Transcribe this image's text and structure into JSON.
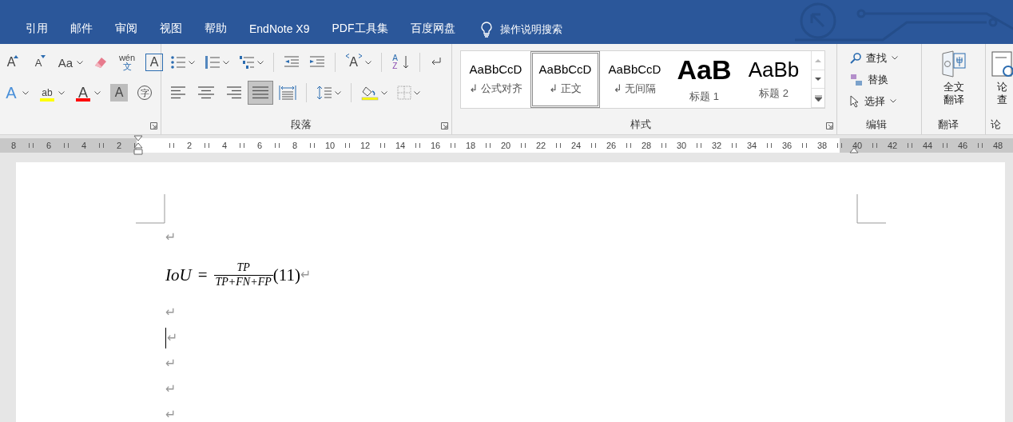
{
  "tabs": [
    {
      "label": "引用",
      "selected": false
    },
    {
      "label": "邮件",
      "selected": false
    },
    {
      "label": "审阅",
      "selected": false
    },
    {
      "label": "视图",
      "selected": false
    },
    {
      "label": "帮助",
      "selected": false
    },
    {
      "label": "EndNote X9",
      "selected": false
    },
    {
      "label": "PDF工具集",
      "selected": false
    },
    {
      "label": "百度网盘",
      "selected": false
    }
  ],
  "tell_me": {
    "placeholder": "操作说明搜索"
  },
  "font_group": {
    "row1": [
      {
        "kind": "grow",
        "glyph": "A",
        "dropdown": false
      },
      {
        "kind": "shrink",
        "glyph": "A",
        "dropdown": false
      },
      {
        "kind": "case",
        "glyph": "Aa",
        "dropdown": true
      },
      {
        "kind": "eraser",
        "dropdown": false
      },
      {
        "kind": "phonetic",
        "glyph": "wén",
        "sub": "文",
        "dropdown": false
      },
      {
        "kind": "boxed",
        "glyph": "A",
        "dropdown": false
      }
    ],
    "row2": [
      {
        "kind": "effect",
        "glyph": "A",
        "dropdown": true
      },
      {
        "kind": "highlight",
        "glyph": "ab",
        "dropdown": true,
        "color": "#ffff00"
      },
      {
        "kind": "fontcolor",
        "glyph": "A",
        "dropdown": true,
        "color": "#ff0000"
      },
      {
        "kind": "shaded",
        "glyph": "A",
        "dropdown": false
      },
      {
        "kind": "enclosed",
        "glyph": "字",
        "dropdown": false
      }
    ]
  },
  "paragraph_group": {
    "label": "段落",
    "row1": [
      {
        "kind": "bullets",
        "dropdown": true,
        "selected": false
      },
      {
        "kind": "numbering",
        "dropdown": true,
        "selected": false
      },
      {
        "kind": "multilevel",
        "dropdown": true,
        "selected": false
      },
      {
        "kind": "sep"
      },
      {
        "kind": "outdent",
        "dropdown": false,
        "selected": false
      },
      {
        "kind": "indent",
        "dropdown": false,
        "selected": false
      },
      {
        "kind": "sep"
      },
      {
        "kind": "asian",
        "glyph": "A",
        "dropdown": true,
        "selected": false
      },
      {
        "kind": "sep"
      },
      {
        "kind": "sort",
        "glyph": "A",
        "sub": "Z",
        "dropdown": false,
        "selected": false
      },
      {
        "kind": "sep"
      },
      {
        "kind": "marks",
        "dropdown": false,
        "selected": false
      }
    ],
    "row2": [
      {
        "kind": "left",
        "dropdown": false,
        "selected": false
      },
      {
        "kind": "center",
        "dropdown": false,
        "selected": false
      },
      {
        "kind": "right",
        "dropdown": false,
        "selected": false
      },
      {
        "kind": "justify",
        "dropdown": false,
        "selected": true
      },
      {
        "kind": "distribute",
        "dropdown": false,
        "selected": false
      },
      {
        "kind": "sep"
      },
      {
        "kind": "spacing",
        "dropdown": true,
        "selected": false
      },
      {
        "kind": "sep"
      },
      {
        "kind": "shading",
        "dropdown": true,
        "selected": false
      },
      {
        "kind": "borders",
        "dropdown": true,
        "selected": false
      }
    ]
  },
  "styles_group": {
    "label": "样式",
    "items": [
      {
        "preview": "AaBbCcD",
        "name": "公式对齐",
        "mark": "↲",
        "kind": "normal",
        "selected": false
      },
      {
        "preview": "AaBbCcD",
        "name": "正文",
        "mark": "↲",
        "kind": "normal",
        "selected": true
      },
      {
        "preview": "AaBbCcD",
        "name": "无间隔",
        "mark": "↲",
        "kind": "normal",
        "selected": false
      },
      {
        "preview": "AaB",
        "name": "标题 1",
        "kind": "heading1",
        "selected": false
      },
      {
        "preview": "AaBb",
        "name": "标题 2",
        "kind": "heading2",
        "selected": false
      }
    ]
  },
  "editing_group": {
    "label": "编辑",
    "items": [
      {
        "kind": "find",
        "label": "查找",
        "dropdown": true
      },
      {
        "kind": "replace",
        "label": "替换",
        "dropdown": false
      },
      {
        "kind": "select",
        "label": "选择",
        "dropdown": true
      }
    ]
  },
  "translate_group": {
    "label": "翻译",
    "button": "全文翻译"
  },
  "paper_group": {
    "label": "论",
    "button": "论查"
  },
  "ruler": [
    {
      "label": "8",
      "margin": true
    },
    {
      "label": "6",
      "margin": true
    },
    {
      "label": "4",
      "margin": true
    },
    {
      "label": "2",
      "margin": true
    },
    {
      "margin": false
    },
    {
      "label": "2",
      "margin": false
    },
    {
      "label": "4",
      "margin": false
    },
    {
      "label": "6",
      "margin": false
    },
    {
      "label": "8",
      "margin": false
    },
    {
      "label": "10",
      "margin": false
    },
    {
      "label": "12",
      "margin": false
    },
    {
      "label": "14",
      "margin": false
    },
    {
      "label": "16",
      "margin": false
    },
    {
      "label": "18",
      "margin": false
    },
    {
      "label": "20",
      "margin": false
    },
    {
      "label": "22",
      "margin": false
    },
    {
      "label": "24",
      "margin": false
    },
    {
      "label": "26",
      "margin": false
    },
    {
      "label": "28",
      "margin": false
    },
    {
      "label": "30",
      "margin": false
    },
    {
      "label": "32",
      "margin": false
    },
    {
      "label": "34",
      "margin": false
    },
    {
      "label": "36",
      "margin": false
    },
    {
      "label": "38",
      "margin": false
    },
    {
      "label": "40",
      "margin": true
    },
    {
      "label": "42",
      "margin": true
    },
    {
      "label": "44",
      "margin": true
    },
    {
      "label": "46",
      "margin": true
    },
    {
      "label": "48",
      "margin": true
    }
  ],
  "document": [
    {
      "kind": "empty",
      "mark": "↵",
      "cursor": false
    },
    {
      "kind": "equation",
      "lhs": "IoU",
      "eq": "=",
      "numerator": "TP",
      "denominator": "TP+FN+FP",
      "number": "(11)",
      "mark": "↵"
    },
    {
      "kind": "empty",
      "mark": "↵",
      "cursor": false
    },
    {
      "kind": "empty",
      "mark": "↵",
      "cursor": true
    },
    {
      "kind": "empty",
      "mark": "↵",
      "cursor": false
    },
    {
      "kind": "empty",
      "mark": "↵",
      "cursor": false
    },
    {
      "kind": "empty",
      "mark": "↵",
      "cursor": false
    }
  ]
}
